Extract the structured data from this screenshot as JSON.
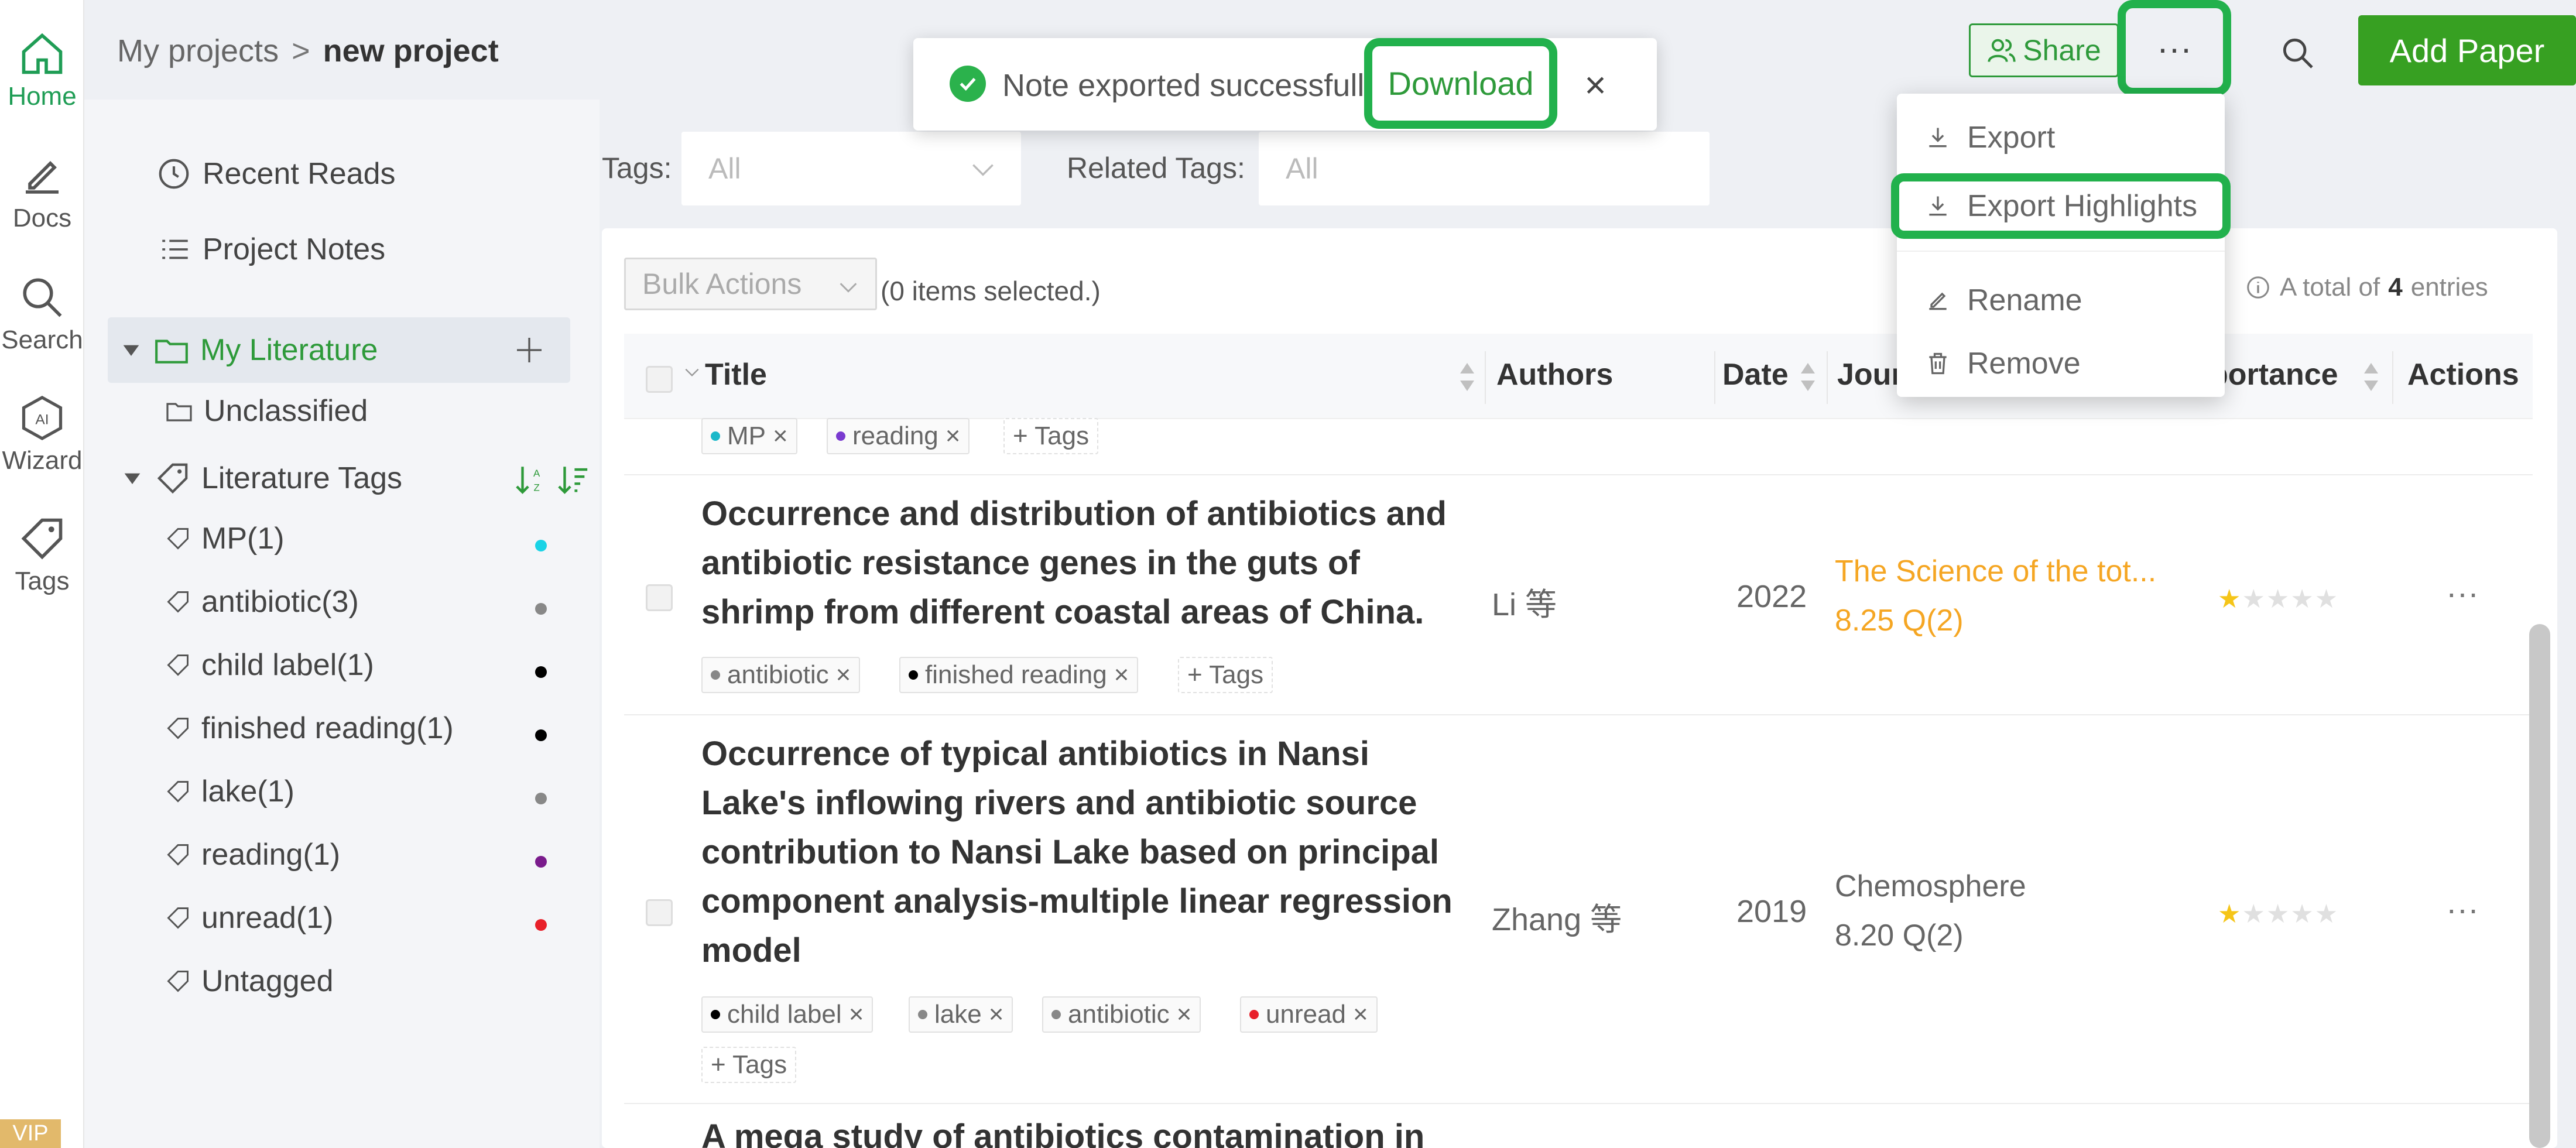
{
  "rail": {
    "items": [
      {
        "label": "Home",
        "icon": "home-icon"
      },
      {
        "label": "Docs",
        "icon": "docs-icon"
      },
      {
        "label": "Search",
        "icon": "search-icon"
      },
      {
        "label": "Wizard",
        "icon": "ai-wizard-icon"
      },
      {
        "label": "Tags",
        "icon": "tag-icon"
      }
    ],
    "vip": "VIP"
  },
  "header": {
    "breadcrumb_root": "My projects",
    "breadcrumb_sep": ">",
    "breadcrumb_current": "new project",
    "share_label": "Share",
    "more_label": "···",
    "add_paper_label": "Add Paper"
  },
  "toast": {
    "message": "Note exported successfully,",
    "download_label": "Download",
    "close_label": "×"
  },
  "dropdown": {
    "export": "Export",
    "export_highlights": "Export Highlights",
    "rename": "Rename",
    "remove": "Remove"
  },
  "sidebar": {
    "recent_reads": "Recent Reads",
    "project_notes": "Project Notes",
    "my_literature": "My Literature",
    "unclassified": "Unclassified",
    "literature_tags": "Literature Tags",
    "tags": [
      {
        "label": "MP(1)",
        "color": "#1ad3e6"
      },
      {
        "label": "antibiotic(3)",
        "color": "#888888"
      },
      {
        "label": "child label(1)",
        "color": "#000000"
      },
      {
        "label": "finished reading(1)",
        "color": "#000000"
      },
      {
        "label": "lake(1)",
        "color": "#888888"
      },
      {
        "label": "reading(1)",
        "color": "#7a1b8c"
      },
      {
        "label": "unread(1)",
        "color": "#e8202a"
      }
    ],
    "untagged": "Untagged"
  },
  "filters": {
    "tags_label": "Tags:",
    "tags_value": "All",
    "related_label": "Related Tags:",
    "related_value": "All"
  },
  "table": {
    "bulk_actions": "Bulk Actions",
    "selected_count": "(0 items selected.)",
    "total_prefix": "A total of",
    "total_count": "4",
    "total_suffix": "entries",
    "columns": {
      "title": "Title",
      "authors": "Authors",
      "date": "Date",
      "journal": "Jour",
      "importance": "portance",
      "actions": "Actions"
    },
    "first_row_tags": [
      {
        "label": "MP",
        "color": "#1ab8c9"
      },
      {
        "label": "reading",
        "color": "#7a3bd0"
      }
    ],
    "add_tags_label": "+ Tags",
    "rows": [
      {
        "title": "Occurrence and distribution of antibiotics and antibiotic resistance genes in the guts of shrimp from different coastal areas of China.",
        "authors": "Li 等",
        "date": "2022",
        "journal": "The Science of the tot...",
        "journal_metric": "8.25 Q(2)",
        "journal_color": "#f5a623",
        "stars": 1,
        "actions": "···",
        "tags": [
          {
            "label": "antibiotic",
            "color": "#888888"
          },
          {
            "label": "finished reading",
            "color": "#000000"
          }
        ]
      },
      {
        "title": "Occurrence of typical antibiotics in Nansi Lake's inflowing rivers and antibiotic source contribution to Nansi Lake based on principal component analysis-multiple linear regression model",
        "authors": "Zhang 等",
        "date": "2019",
        "journal": "Chemosphere",
        "journal_metric": "8.20 Q(2)",
        "journal_color": "#666666",
        "stars": 1,
        "actions": "···",
        "tags": [
          {
            "label": "child label",
            "color": "#000000"
          },
          {
            "label": "lake",
            "color": "#888888"
          },
          {
            "label": "antibiotic",
            "color": "#888888"
          },
          {
            "label": "unread",
            "color": "#e8202a"
          }
        ]
      },
      {
        "title": "A mega study of antibiotics contamination in"
      }
    ]
  }
}
